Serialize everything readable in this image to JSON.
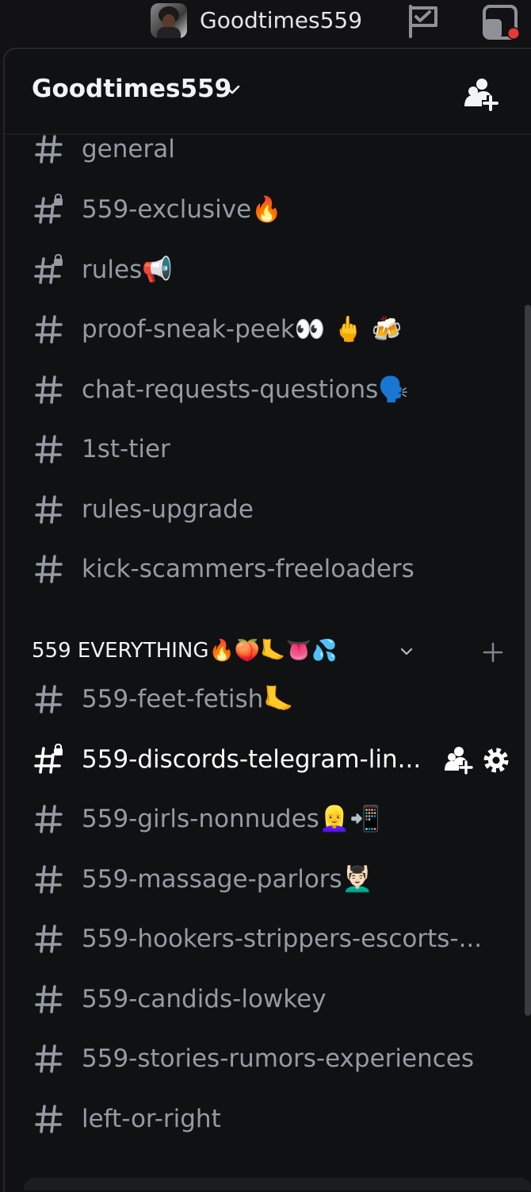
{
  "topbar": {
    "title": "Goodtimes559"
  },
  "server": {
    "name": "Goodtimes559"
  },
  "channels_top": [
    {
      "name": "general",
      "locked": false
    },
    {
      "name": "559-exclusive🔥",
      "locked": true
    },
    {
      "name": "rules📢",
      "locked": true
    },
    {
      "name": "proof-sneak-peek👀 🖕 🍻",
      "locked": false
    },
    {
      "name": "chat-requests-questions🗣️",
      "locked": false
    },
    {
      "name": "1st-tier",
      "locked": false
    },
    {
      "name": "rules-upgrade",
      "locked": false
    },
    {
      "name": "kick-scammers-freeloaders",
      "locked": false
    }
  ],
  "category": {
    "name": "559 EVERYTHING🔥🍑🦶👅💦"
  },
  "channels_bottom": [
    {
      "name": "559-feet-fetish🦶",
      "locked": false
    },
    {
      "name": "559-discords-telegram-lin...",
      "locked": true,
      "active": true
    },
    {
      "name": "559-girls-nonnudes👱‍♀️📲",
      "locked": false
    },
    {
      "name": "559-massage-parlors💆🏻‍♂️",
      "locked": false
    },
    {
      "name": "559-hookers-strippers-escorts-...",
      "locked": false
    },
    {
      "name": "559-candids-lowkey",
      "locked": false
    },
    {
      "name": "559-stories-rumors-experiences",
      "locked": false
    },
    {
      "name": "left-or-right",
      "locked": false
    }
  ],
  "colors": {
    "background": "#101113",
    "channel_text": "#949ba4",
    "active_text": "#ffffff",
    "notification_dot": "#e53935"
  },
  "icons": {
    "hash": "hash-icon",
    "locked_hash": "locked-hash-icon",
    "flag": "flag-icon",
    "inbox": "inbox-icon",
    "invite": "add-member-icon",
    "settings": "gear-icon"
  }
}
